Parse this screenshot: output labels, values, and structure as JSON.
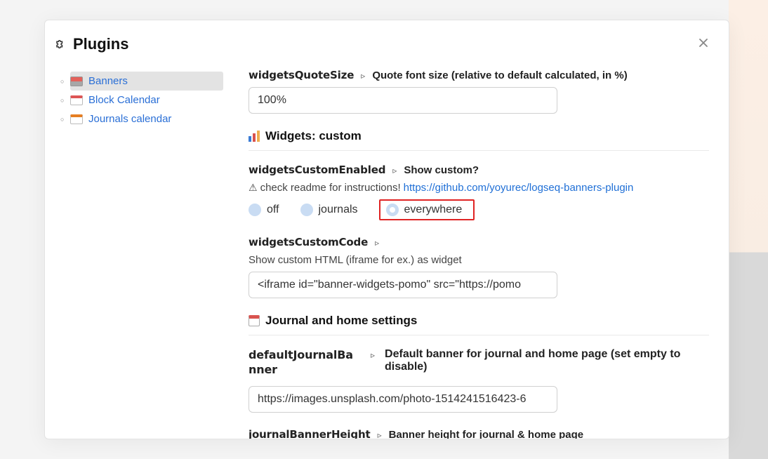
{
  "modal": {
    "title": "Plugins"
  },
  "sidebar": {
    "items": [
      {
        "label": "Banners"
      },
      {
        "label": "Block Calendar"
      },
      {
        "label": "Journals calendar"
      }
    ]
  },
  "settings": {
    "quoteSize": {
      "key": "widgetsQuoteSize",
      "desc": "Quote font size (relative to default calculated, in %)",
      "value": "100%"
    },
    "section_custom": "Widgets: custom",
    "customEnabled": {
      "key": "widgetsCustomEnabled",
      "desc": "Show custom?",
      "help_pre": "check readme for instructions!",
      "help_link": "https://github.com/yoyurec/logseq-banners-plugin",
      "options": [
        {
          "label": "off",
          "selected": false
        },
        {
          "label": "journals",
          "selected": false
        },
        {
          "label": "everywhere",
          "selected": true
        }
      ]
    },
    "customCode": {
      "key": "widgetsCustomCode",
      "help": "Show custom HTML (iframe for ex.) as widget",
      "value": "<iframe id=\"banner-widgets-pomo\" src=\"https://pomo"
    },
    "section_journal": "Journal and home settings",
    "defaultJournalBanner": {
      "key": "defaultJournalBanner",
      "desc": "Default banner for journal and home page (set empty to disable)",
      "value": "https://images.unsplash.com/photo-1514241516423-6"
    },
    "journalBannerHeight": {
      "key": "journalBannerHeight",
      "desc": "Banner height for journal & home page"
    }
  }
}
